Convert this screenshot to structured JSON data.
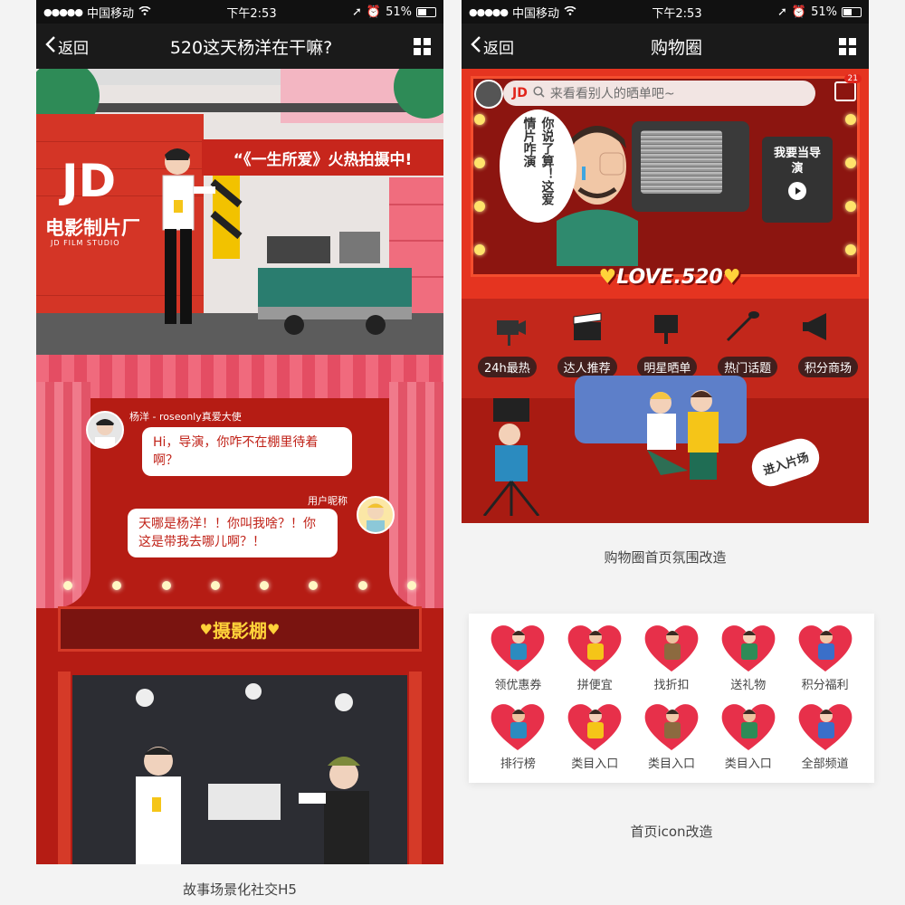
{
  "status_bar": {
    "carrier": "中国移动",
    "time": "下午2:53",
    "battery": "51%"
  },
  "left_phone": {
    "nav": {
      "back_label": "返回",
      "title": "520这天杨洋在干嘛?"
    },
    "scene": {
      "logo": "JD",
      "studio_cn": "电影制片厂",
      "studio_en": "JD FILM STUDIO",
      "banner": "“《一生所爱》火热拍摄中!"
    },
    "chat": [
      {
        "name": "杨洋 - roseonly真爱大使",
        "text": "Hi，导演，你咋不在棚里待着啊？"
      },
      {
        "name": "用户昵称",
        "text": "天哪是杨洋！！你叫我啥？！你这是带我去哪儿啊？！"
      }
    ],
    "stage_sign": "摄影棚"
  },
  "right_phone": {
    "nav": {
      "back_label": "返回",
      "title": "购物圈"
    },
    "search": {
      "brand": "JD",
      "placeholder": "来看看别人的晒单吧~"
    },
    "message_badge": "21",
    "speech_text": "你说了算！这爱情片咋演",
    "small_tv_text": "我要当导演",
    "love_sign": "LOVE.520",
    "tags": [
      "24h最热",
      "达人推荐",
      "明星晒单",
      "热门话题",
      "积分商场"
    ],
    "enter_sign": "进入片场"
  },
  "icon_card": {
    "items": [
      {
        "label": "领优惠券",
        "icon": "couple-hug-icon"
      },
      {
        "label": "拼便宜",
        "icon": "couple-hug-icon"
      },
      {
        "label": "找折扣",
        "icon": "man-with-bag-icon"
      },
      {
        "label": "送礼物",
        "icon": "gift-icon"
      },
      {
        "label": "积分福利",
        "icon": "man-with-phone-icon"
      },
      {
        "label": "排行榜",
        "icon": "love-you-icon"
      },
      {
        "label": "类目入口",
        "icon": "girl-icon"
      },
      {
        "label": "类目入口",
        "icon": "love-bubble-icon"
      },
      {
        "label": "类目入口",
        "icon": "couple-icon"
      },
      {
        "label": "全部频道",
        "icon": "ring-proposal-icon"
      }
    ]
  },
  "captions": {
    "left": "故事场景化社交H5",
    "right_top": "购物圈首页氛围改造",
    "right_bottom": "首页icon改造"
  },
  "colors": {
    "brand_red": "#e1251b",
    "stage_red": "#b51c14",
    "nav_dark": "#1a1a1a",
    "gold": "#ffd23a"
  }
}
